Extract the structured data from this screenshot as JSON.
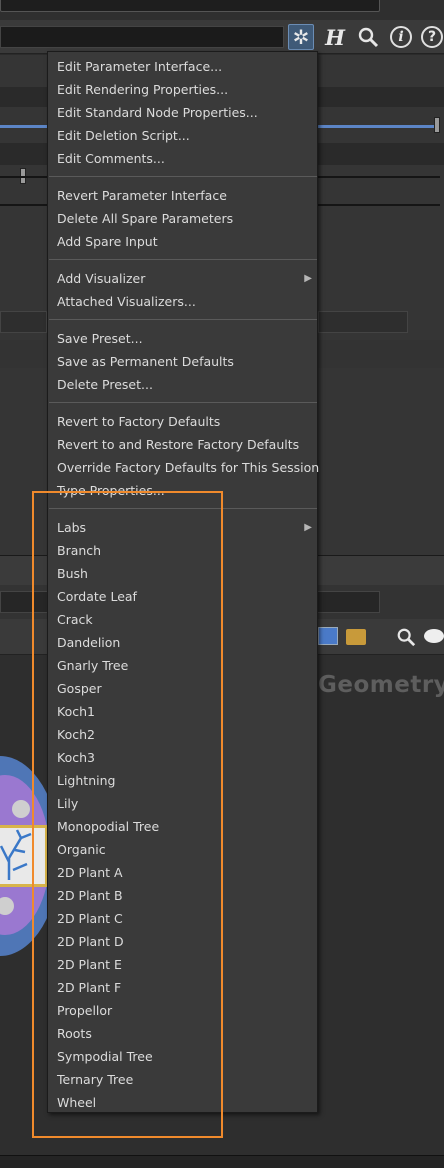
{
  "canvas_label": "Geometry",
  "menu": {
    "groups": [
      [
        {
          "label": "Edit Parameter Interface..."
        },
        {
          "label": "Edit Rendering Properties..."
        },
        {
          "label": "Edit Standard Node Properties..."
        },
        {
          "label": "Edit Deletion Script..."
        },
        {
          "label": "Edit Comments..."
        }
      ],
      [
        {
          "label": "Revert Parameter Interface"
        },
        {
          "label": "Delete All Spare Parameters"
        },
        {
          "label": "Add Spare Input"
        }
      ],
      [
        {
          "label": "Add Visualizer",
          "submenu": true
        },
        {
          "label": "Attached Visualizers..."
        }
      ],
      [
        {
          "label": "Save Preset..."
        },
        {
          "label": "Save as Permanent Defaults"
        },
        {
          "label": "Delete Preset..."
        }
      ],
      [
        {
          "label": "Revert to Factory Defaults"
        },
        {
          "label": "Revert to and Restore Factory Defaults"
        },
        {
          "label": "Override Factory Defaults for This Session"
        },
        {
          "label": "Type Properties..."
        }
      ],
      [
        {
          "label": "Labs",
          "submenu": true
        },
        {
          "label": "Branch"
        },
        {
          "label": "Bush"
        },
        {
          "label": "Cordate Leaf"
        },
        {
          "label": "Crack"
        },
        {
          "label": "Dandelion"
        },
        {
          "label": "Gnarly Tree"
        },
        {
          "label": "Gosper"
        },
        {
          "label": "Koch1"
        },
        {
          "label": "Koch2"
        },
        {
          "label": "Koch3"
        },
        {
          "label": "Lightning"
        },
        {
          "label": "Lily"
        },
        {
          "label": "Monopodial Tree"
        },
        {
          "label": "Organic"
        },
        {
          "label": "2D Plant A"
        },
        {
          "label": "2D Plant B"
        },
        {
          "label": "2D Plant C"
        },
        {
          "label": "2D Plant D"
        },
        {
          "label": "2D Plant E"
        },
        {
          "label": "2D Plant F"
        },
        {
          "label": "Propellor"
        },
        {
          "label": "Roots"
        },
        {
          "label": "Sympodial Tree"
        },
        {
          "label": "Ternary Tree"
        },
        {
          "label": "Wheel"
        }
      ]
    ]
  },
  "colors": {
    "highlight": "#f08a2c",
    "menu_bg": "#3a3a3a",
    "accent": "#5c85c6"
  }
}
